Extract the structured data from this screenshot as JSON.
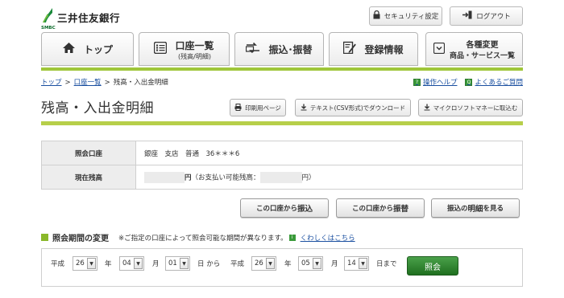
{
  "header": {
    "bank_name": "三井住友銀行",
    "bank_sub": "SMBC",
    "security_label": "セキュリティ設定",
    "logout_label": "ログアウト"
  },
  "nav": {
    "tabs": [
      {
        "label": "トップ"
      },
      {
        "label": "口座一覧",
        "sub": "(残高/明細)"
      },
      {
        "label": "振込･振替"
      },
      {
        "label": "登録情報"
      },
      {
        "label": "各種変更",
        "sub": "商品・サービス一覧"
      }
    ]
  },
  "breadcrumb": {
    "items": [
      "トップ",
      "口座一覧",
      "残高・入出金明細"
    ],
    "sep": ">"
  },
  "help": {
    "manual_label": "操作ヘルプ",
    "faq_label": "よくあるご質問"
  },
  "page": {
    "title": "残高・入出金明細"
  },
  "actions": {
    "print_label": "印刷用ページ",
    "csv_label": "テキスト(CSV形式)でダウンロード",
    "money_label": "マイクロソフトマネーに取込む"
  },
  "account": {
    "account_label": "照会口座",
    "account_value": "銀座　支店　普通　36＊＊＊6",
    "balance_label": "現在残高",
    "balance_unit": "円",
    "available_prefix": "（お支払い可能残高：",
    "available_suffix": "円）"
  },
  "transfer": {
    "furikomi_pre": "この口座から",
    "furikomi_em": "振込",
    "furikae_pre": "この口座から",
    "furikae_em": "振替",
    "detail_pre": "振込の",
    "detail_em": "明細",
    "detail_post": "を見る"
  },
  "period": {
    "section_title": "照会期間の変更",
    "note": "※ご指定の口座によって照会可能な期間が異なります。",
    "link_label": "くわしくはこちら",
    "era_label": "平成",
    "year_unit": "年",
    "month_unit": "月",
    "day_unit_from": "日 から",
    "day_unit_to": "日まで",
    "from": {
      "year": "26",
      "month": "04",
      "day": "01"
    },
    "to": {
      "year": "26",
      "month": "05",
      "day": "14"
    },
    "search_label": "照会"
  },
  "colors": {
    "accent_green": "#9fc63a",
    "button_green": "#2d7f2d",
    "link_blue": "#1a4fa0"
  }
}
